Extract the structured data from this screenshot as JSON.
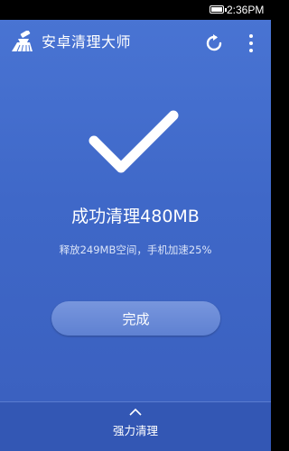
{
  "status_bar": {
    "time": "2:36PM"
  },
  "app_bar": {
    "title": "安卓清理大师",
    "icons": [
      "broom-icon",
      "refresh-icon",
      "more-vert-icon"
    ]
  },
  "result": {
    "icon": "checkmark-icon",
    "title": "成功清理480MB",
    "subtitle": "释放249MB空间，手机加速25%"
  },
  "actions": {
    "done_label": "完成"
  },
  "bottom": {
    "label": "强力清理",
    "icon": "chevron-up-icon"
  },
  "colors": {
    "background": "#4169CB",
    "button": "#6A8AD7",
    "bottom_bar": "#3357B4",
    "text": "#FFFFFF"
  }
}
